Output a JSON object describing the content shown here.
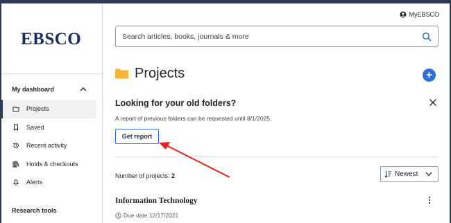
{
  "brand": {
    "logo_text": "EBSCO"
  },
  "header": {
    "account_label": "MyEBSCO"
  },
  "search": {
    "placeholder": "Search articles, books, journals & more"
  },
  "sidebar": {
    "section_title": "My dashboard",
    "items": [
      {
        "label": "Projects",
        "icon": "folder-icon",
        "active": true
      },
      {
        "label": "Saved",
        "icon": "bookmark-icon"
      },
      {
        "label": "Recent activity",
        "icon": "history-icon"
      },
      {
        "label": "Holds & checkouts",
        "icon": "books-icon"
      },
      {
        "label": "Alerts",
        "icon": "bell-icon"
      }
    ],
    "research_title": "Research tools"
  },
  "page": {
    "title": "Projects"
  },
  "notice": {
    "title": "Looking for your old folders?",
    "text": "A report of previous folders can be requested until 8/1/2025.",
    "button_label": "Get report"
  },
  "list": {
    "count_label": "Number of projects:",
    "count_value": "2",
    "sort_label": "Newest",
    "items": [
      {
        "name": "Information Technology",
        "due": "Due date 12/17/2021"
      }
    ]
  },
  "colors": {
    "accent": "#2f6ed9",
    "brand": "#1b2d5b",
    "folder": "#f5b335",
    "annotation": "#e8221c"
  }
}
